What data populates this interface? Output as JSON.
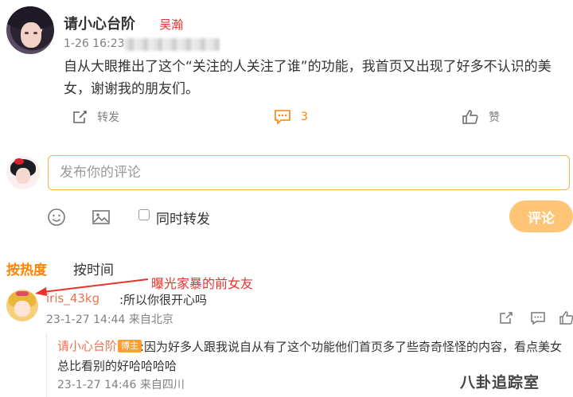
{
  "post": {
    "author": "请小心台阶",
    "annotation_name": "吴瀚",
    "timestamp": "1-26 16:23",
    "text": "自从大眼推出了这个“关注的人关注了谁”的功能，我首页又出现了好多不认识的美女，谢谢我的朋友们。",
    "repost_label": "转发",
    "comment_count": "3",
    "like_label": "赞"
  },
  "composer": {
    "placeholder": "发布你的评论",
    "repost_checkbox_label": "同时转发",
    "submit_label": "评论"
  },
  "sort_tabs": {
    "hot": "按热度",
    "time": "按时间"
  },
  "annotation_arrow_text": "曝光家暴的前女友",
  "comments": [
    {
      "user": "iris_43kg",
      "text": ":所以你很开心吗",
      "meta": "23-1-27 14:44 来自北京",
      "reply": {
        "user": "请小心台阶",
        "badge": "博主",
        "text": ":因为好多人跟我说自从有了这个功能他们首页多了些奇奇怪怪的内容，看点美女总比看别的好哈哈哈哈",
        "meta": "23-1-27 14:46 来自四川"
      }
    }
  ],
  "watermark": "八卦追踪室",
  "colors": {
    "accent": "#ff8200",
    "username": "#eb7350",
    "annotation": "#e8322b",
    "submit_bg": "#ffc476",
    "input_border": "#f5b24a"
  }
}
